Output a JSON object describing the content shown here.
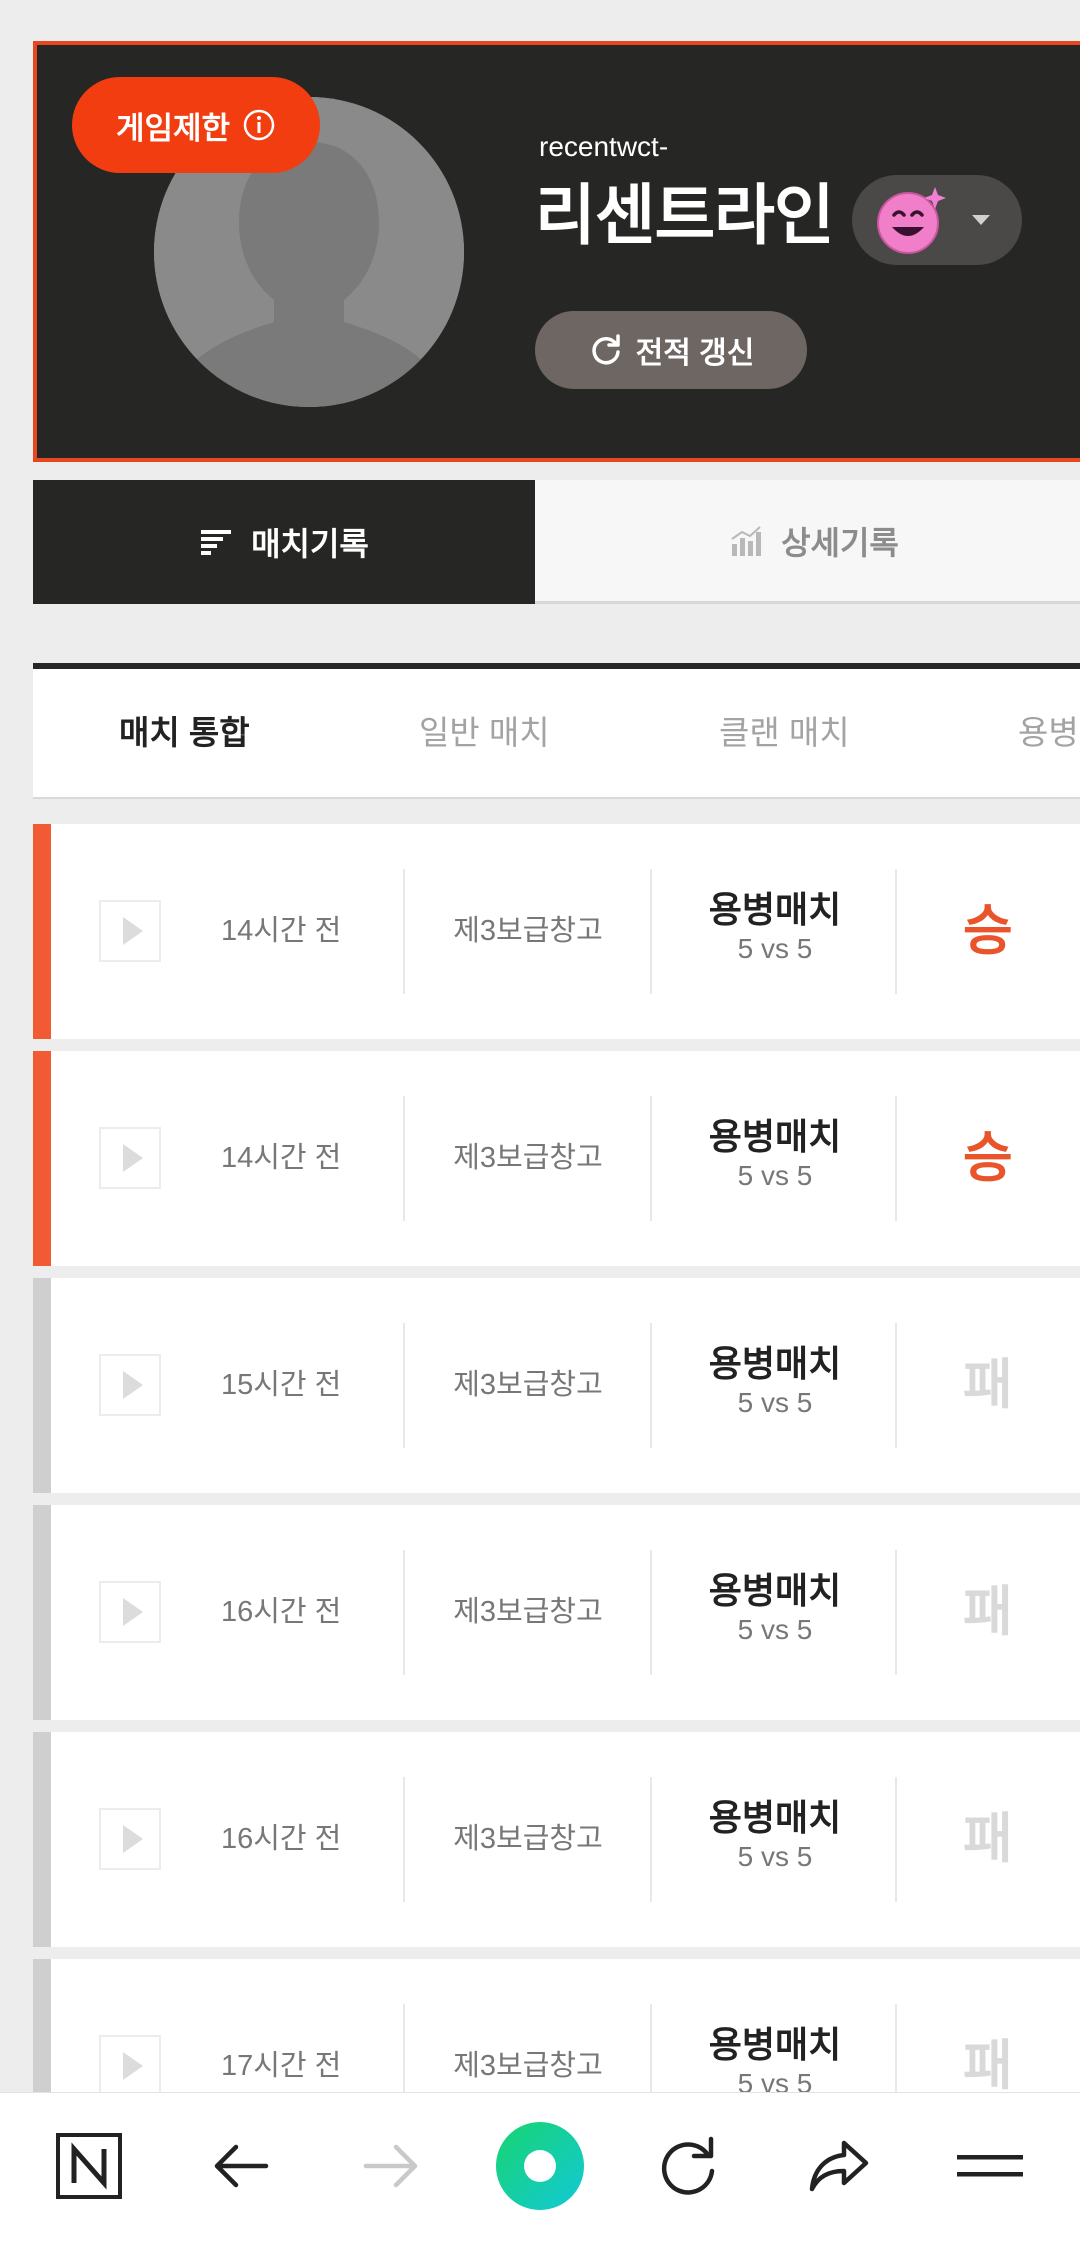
{
  "profile": {
    "restrict_label": "게임제한",
    "userid": "recentwct-",
    "nickname": "리센트라인",
    "refresh_label": "전적 갱신"
  },
  "main_tabs": [
    {
      "label": "매치기록",
      "active": true
    },
    {
      "label": "상세기록",
      "active": false
    }
  ],
  "sub_tabs": [
    {
      "label": "매치 통합",
      "active": true
    },
    {
      "label": "일반 매치",
      "active": false
    },
    {
      "label": "클랜 매치",
      "active": false
    },
    {
      "label": "용병",
      "active": false
    }
  ],
  "matches": [
    {
      "time": "14시간 전",
      "map": "제3보급창고",
      "mode": "용병매치",
      "size": "5 vs 5",
      "result": "승",
      "outcome": "win"
    },
    {
      "time": "14시간 전",
      "map": "제3보급창고",
      "mode": "용병매치",
      "size": "5 vs 5",
      "result": "승",
      "outcome": "win"
    },
    {
      "time": "15시간 전",
      "map": "제3보급창고",
      "mode": "용병매치",
      "size": "5 vs 5",
      "result": "패",
      "outcome": "lose"
    },
    {
      "time": "16시간 전",
      "map": "제3보급창고",
      "mode": "용병매치",
      "size": "5 vs 5",
      "result": "패",
      "outcome": "lose"
    },
    {
      "time": "16시간 전",
      "map": "제3보급창고",
      "mode": "용병매치",
      "size": "5 vs 5",
      "result": "패",
      "outcome": "lose"
    },
    {
      "time": "17시간 전",
      "map": "제3보급창고",
      "mode": "용병매치",
      "size": "5 vs 5",
      "result": "패",
      "outcome": "lose"
    }
  ],
  "colors": {
    "accent": "#f23d11",
    "win": "#e9542b",
    "lose": "#d9d9d9",
    "dark": "#262624"
  },
  "bottom_bar": {
    "icons": [
      "naver-n-icon",
      "back-arrow-icon",
      "forward-arrow-icon",
      "green-dot-home-icon",
      "refresh-icon",
      "share-icon",
      "menu-icon"
    ]
  }
}
